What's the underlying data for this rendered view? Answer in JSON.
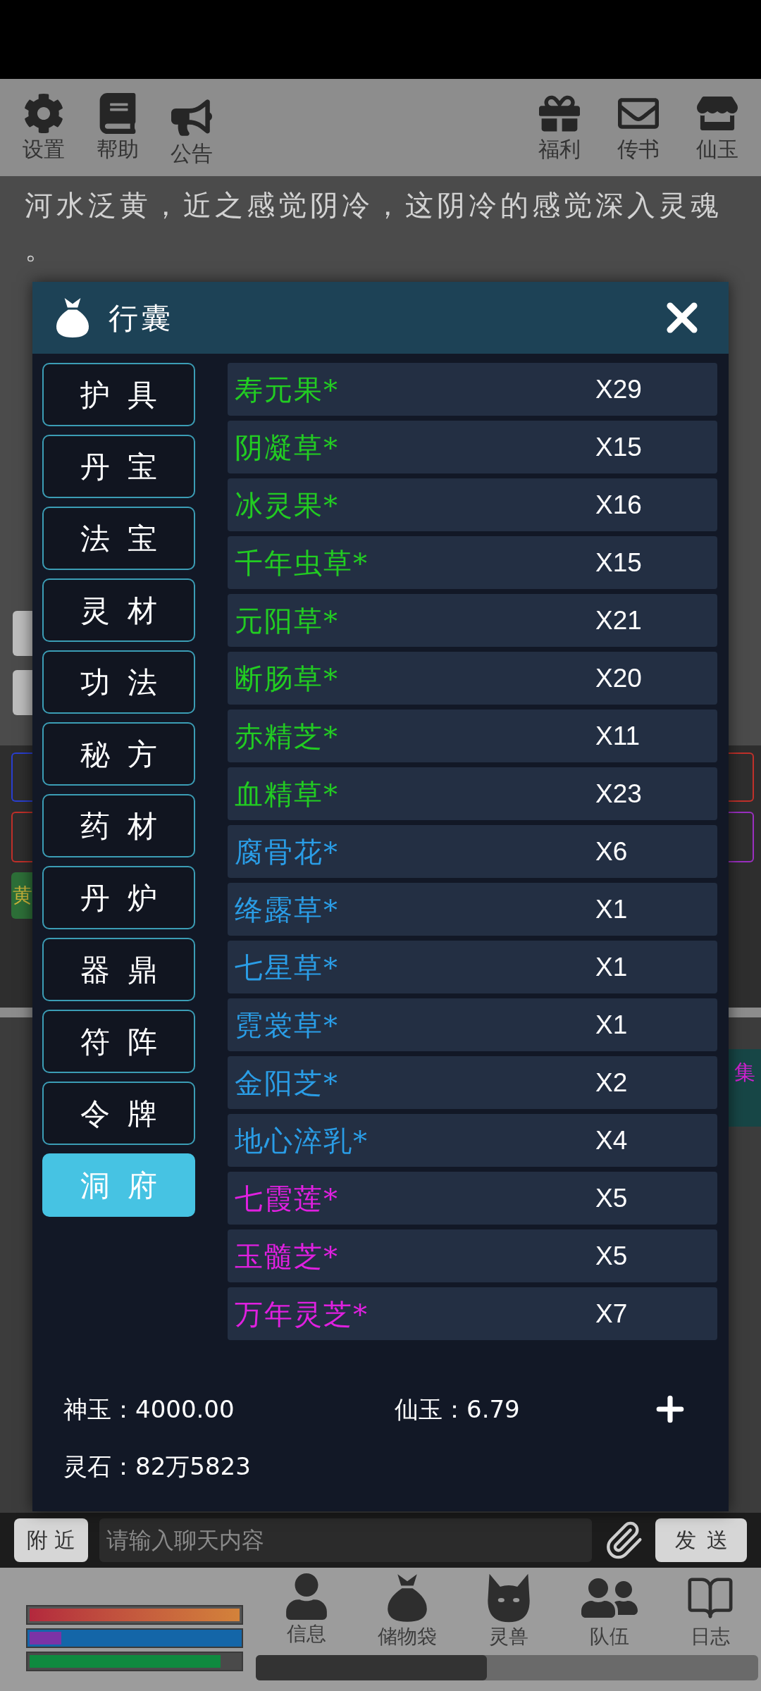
{
  "toolbar": {
    "left": [
      {
        "label": "设置"
      },
      {
        "label": "帮助"
      },
      {
        "label": "公告"
      }
    ],
    "right": [
      {
        "label": "福利"
      },
      {
        "label": "传书"
      },
      {
        "label": "仙玉"
      }
    ]
  },
  "story": {
    "text": "河水泛黄，近之感觉阴冷，这阴冷的感觉深入灵魂。"
  },
  "side_fragments": {
    "left_tag": "黄",
    "right_tab": "集"
  },
  "bag": {
    "title": "行囊",
    "categories": [
      {
        "label": "护具",
        "selected": false
      },
      {
        "label": "丹宝",
        "selected": false
      },
      {
        "label": "法宝",
        "selected": false
      },
      {
        "label": "灵材",
        "selected": false
      },
      {
        "label": "功法",
        "selected": false
      },
      {
        "label": "秘方",
        "selected": false
      },
      {
        "label": "药材",
        "selected": false
      },
      {
        "label": "丹炉",
        "selected": false
      },
      {
        "label": "器鼎",
        "selected": false
      },
      {
        "label": "符阵",
        "selected": false
      },
      {
        "label": "令牌",
        "selected": false
      },
      {
        "label": "洞府",
        "selected": true
      }
    ],
    "items": [
      {
        "name": "寿元果*",
        "count": "X29",
        "color": "#22cc22"
      },
      {
        "name": "阴凝草*",
        "count": "X15",
        "color": "#22cc22"
      },
      {
        "name": "冰灵果*",
        "count": "X16",
        "color": "#22cc22"
      },
      {
        "name": "千年虫草*",
        "count": "X15",
        "color": "#22cc22"
      },
      {
        "name": "元阳草*",
        "count": "X21",
        "color": "#22cc22"
      },
      {
        "name": "断肠草*",
        "count": "X20",
        "color": "#22cc22"
      },
      {
        "name": "赤精芝*",
        "count": "X11",
        "color": "#22cc22"
      },
      {
        "name": "血精草*",
        "count": "X23",
        "color": "#22cc22"
      },
      {
        "name": "腐骨花*",
        "count": "X6",
        "color": "#2a9de6"
      },
      {
        "name": "绛露草*",
        "count": "X1",
        "color": "#2a9de6"
      },
      {
        "name": "七星草*",
        "count": "X1",
        "color": "#2a9de6"
      },
      {
        "name": "霓裳草*",
        "count": "X1",
        "color": "#2a9de6"
      },
      {
        "name": "金阳芝*",
        "count": "X2",
        "color": "#2a9de6"
      },
      {
        "name": "地心淬乳*",
        "count": "X4",
        "color": "#2a9de6"
      },
      {
        "name": "七霞莲*",
        "count": "X5",
        "color": "#e020e0"
      },
      {
        "name": "玉髓芝*",
        "count": "X5",
        "color": "#e020e0"
      },
      {
        "name": "万年灵芝*",
        "count": "X7",
        "color": "#e020e0"
      }
    ],
    "currency_rows": [
      [
        "神玉：4000.00",
        "仙玉：6.79"
      ],
      [
        "灵石：82万5823"
      ]
    ]
  },
  "chat": {
    "channel": "附近",
    "placeholder": "请输入聊天内容",
    "send_button": "发送"
  },
  "status_bars": [
    {
      "kind": "gradient",
      "level": 1
    },
    {
      "kind": "two-tone",
      "level": 0.15
    },
    {
      "kind": "plain",
      "level": 0.91
    }
  ],
  "nav": [
    {
      "label": "信息"
    },
    {
      "label": "储物袋"
    },
    {
      "label": "灵兽"
    },
    {
      "label": "队伍"
    },
    {
      "label": "日志"
    }
  ]
}
